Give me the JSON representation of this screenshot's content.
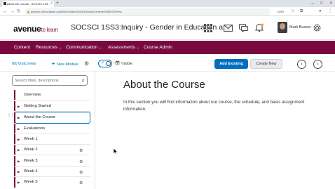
{
  "browser": {
    "tab_title": "About the Course - SOCSCI 1S3...",
    "tab_close": "×",
    "new_tab": "+",
    "url": "avenue.cllmcmaster.ca/d2l/le/content/519015/viewContent/3963878/View",
    "zoom": "133%",
    "back": "←",
    "forward": "→",
    "reload": "↻",
    "minimize": "–",
    "maximize": "□",
    "close": "×"
  },
  "header": {
    "logo_main": "avenue",
    "logo_sub": "to learn",
    "course_title": "SOCSCI 1SS3:Inquiry - Gender in Education a...",
    "user_name": "Mark Busser"
  },
  "navbar": {
    "items": [
      {
        "label": "Content",
        "dropdown": false
      },
      {
        "label": "Resources",
        "dropdown": true
      },
      {
        "label": "Communication",
        "dropdown": true
      },
      {
        "label": "Assessments",
        "dropdown": true
      },
      {
        "label": "Course Admin",
        "dropdown": false
      }
    ],
    "chevron": "⌄"
  },
  "toolbar": {
    "outcomes_label": "0/0 Outcomes",
    "new_module_plus": "+",
    "new_module_label": "New Module",
    "visible_label": "Visible",
    "add_existing_label": "Add Existing",
    "create_new_label": "Create New",
    "prev_glyph": "‹",
    "next_glyph": "›"
  },
  "sidebar": {
    "search_placeholder": "Search titles, descriptions",
    "items": [
      {
        "label": "Overview",
        "arrow": "",
        "has_icon": false,
        "selected": false
      },
      {
        "label": "Getting Started",
        "arrow": "▶",
        "has_icon": false,
        "selected": false
      },
      {
        "label": "About the Course",
        "arrow": "▶",
        "has_icon": false,
        "selected": true
      },
      {
        "label": "Evaluations",
        "arrow": "▶",
        "has_icon": false,
        "selected": false
      },
      {
        "label": "Week 1",
        "arrow": "▶",
        "has_icon": false,
        "selected": false
      },
      {
        "label": "Week 2",
        "arrow": "▶",
        "has_icon": true,
        "selected": false
      },
      {
        "label": "Week 3",
        "arrow": "▶",
        "has_icon": true,
        "selected": false
      },
      {
        "label": "Week 4",
        "arrow": "▶",
        "has_icon": true,
        "selected": false
      },
      {
        "label": "Week 5",
        "arrow": "▶",
        "has_icon": true,
        "selected": false
      }
    ]
  },
  "main": {
    "title": "About the Course",
    "body": "In this section you will find information about our course, the schedule, and basic assignment information."
  },
  "colors": {
    "brand": "#7a0a3e",
    "accent": "#006fbf"
  }
}
